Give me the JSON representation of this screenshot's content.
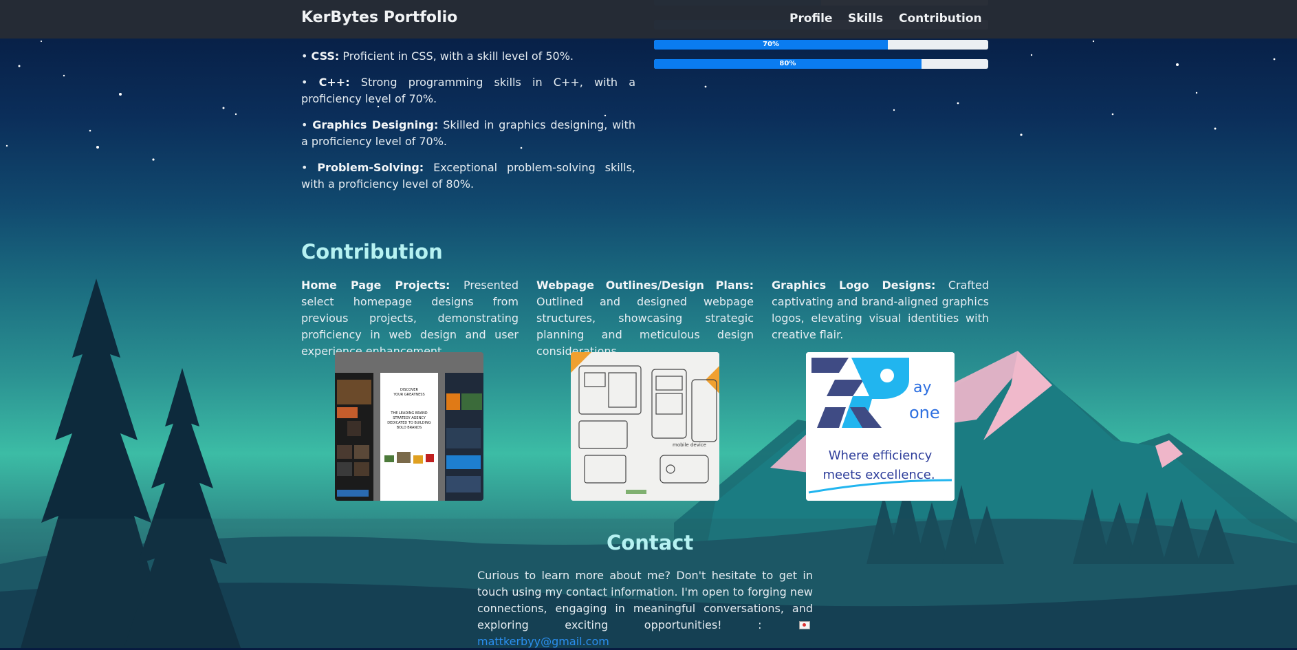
{
  "header": {
    "brand": "KerBytes Portfolio",
    "nav": [
      "Profile",
      "Skills",
      "Contribution"
    ]
  },
  "skills": {
    "items": [
      {
        "title": "CSS:",
        "text": "Proficient in CSS, with a skill level of 50%."
      },
      {
        "title": "C++:",
        "text": "Strong programming skills in C++, with a proficiency level of 70%."
      },
      {
        "title": "Graphics Designing:",
        "text": "Skilled in graphics designing, with a proficiency level of 70%."
      },
      {
        "title": "Problem-Solving:",
        "text": "Exceptional problem-solving skills, with a proficiency level of 80%."
      }
    ],
    "bars": [
      {
        "label": "70%",
        "value": 0.7
      },
      {
        "label": "80%",
        "value": 0.8
      }
    ]
  },
  "contribution": {
    "title": "Contribution",
    "columns": [
      {
        "title": "Home Page Projects:",
        "text": "Presented select homepage designs from previous projects, demonstrating proficiency in web design and user experience enhancement."
      },
      {
        "title": "Webpage Outlines/Design Plans:",
        "text": "Outlined and designed webpage structures, showcasing strategic planning and meticulous design considerations."
      },
      {
        "title": "Graphics Logo Designs:",
        "text": "Crafted captivating and brand-aligned graphics logos, elevating visual identities with creative flair."
      }
    ],
    "thumb1": {
      "heading1": "DISCOVER",
      "heading2": "YOUR GREATNESS",
      "tagline1": "THE LEADING BRAND",
      "tagline2": "STRATEGY AGENCY",
      "tagline3": "DEDICATED TO BUILDING",
      "tagline4": "BOLD BRANDS"
    },
    "thumb2": {
      "note": "mobile device"
    },
    "logo": {
      "ay": "ay",
      "one": "one",
      "line1": "Where efficiency",
      "line2": "meets excellence."
    }
  },
  "contact": {
    "title": "Contact",
    "text": "Curious to learn more about me? Don't hesitate to get in touch using my contact information. I'm open to forging new connections, engaging in meaningful conversations, and exploring exciting opportunities! :",
    "email": "mattkerbyy@gmail.com"
  },
  "colors": {
    "accent": "#0a7cf0",
    "heading": "#b6f2f2",
    "link": "#2b8ff0"
  }
}
